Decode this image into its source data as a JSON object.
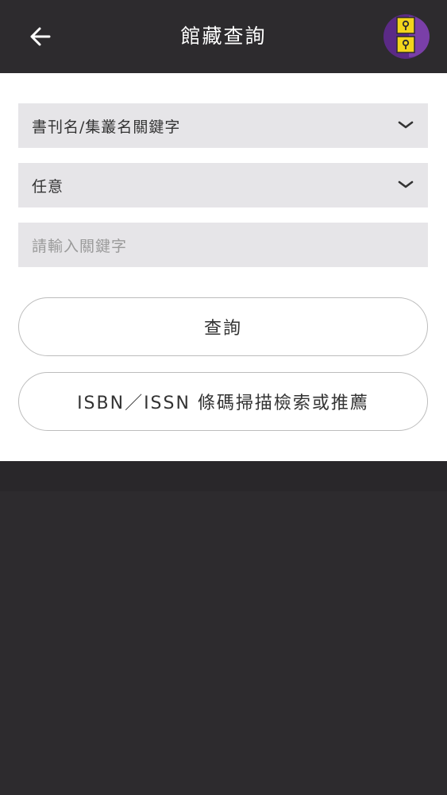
{
  "header": {
    "title": "館藏查詢",
    "back_icon": "arrow-left-icon",
    "logo_icon": "library-logo-icon"
  },
  "search": {
    "field_select": "書刊名/集叢名關鍵字",
    "match_select": "任意",
    "keyword_placeholder": "請輸入關鍵字",
    "keyword_value": ""
  },
  "buttons": {
    "search_label": "查詢",
    "scan_label": "ISBN／ISSN 條碼掃描檢索或推薦"
  },
  "colors": {
    "header_bg": "#2d2b2e",
    "field_bg": "#e6e5e8",
    "logo_purple": "#5b2a86",
    "logo_yellow": "#f2d51b"
  }
}
